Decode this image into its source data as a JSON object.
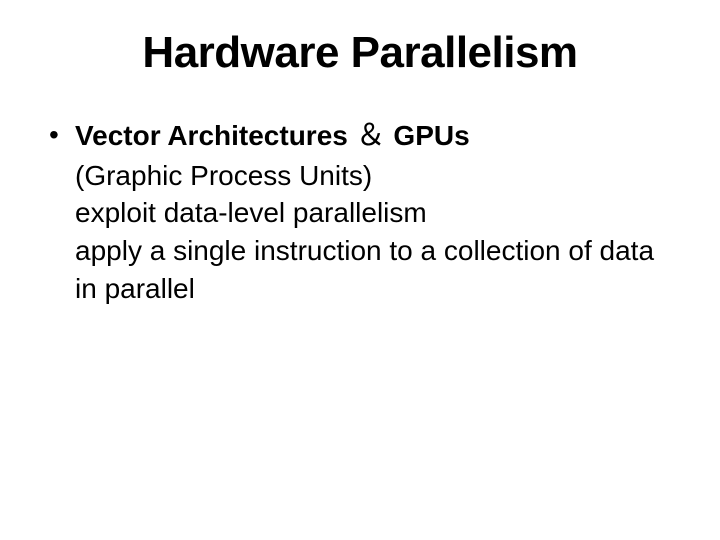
{
  "title": "Hardware Parallelism",
  "bullet": {
    "dot": "•",
    "headline_part1": "Vector Architectures",
    "headline_amp": "＆",
    "headline_part2": "GPUs",
    "sub1": "(Graphic Process Units)",
    "sub2": "exploit data-level parallelism",
    "sub3": "apply a single instruction to a collection of data in parallel"
  }
}
